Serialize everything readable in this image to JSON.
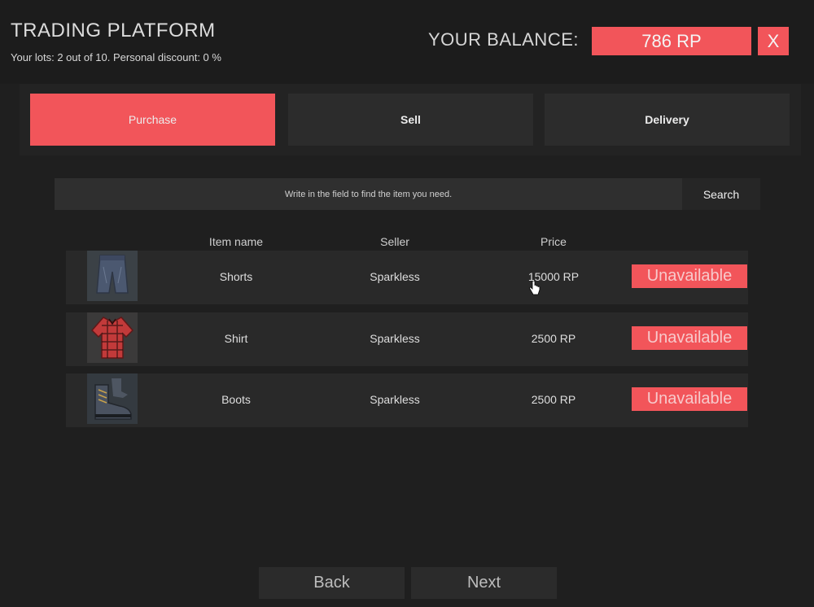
{
  "header": {
    "title": "TRADING PLATFORM",
    "subtitle": "Your lots: 2 out of 10. Personal discount: 0 %",
    "balance_label": "YOUR BALANCE:",
    "balance_value": "786 RP",
    "close_label": "X"
  },
  "tabs": [
    {
      "label": "Purchase",
      "active": true
    },
    {
      "label": "Sell",
      "active": false
    },
    {
      "label": "Delivery",
      "active": false
    }
  ],
  "search": {
    "placeholder": "Write in the field to find the item you need.",
    "button_label": "Search"
  },
  "table": {
    "columns": [
      "Item name",
      "Seller",
      "Price"
    ],
    "rows": [
      {
        "item": "Shorts",
        "seller": "Sparkless",
        "price": "15000 RP",
        "action": "Unavailable",
        "icon": "shorts-icon"
      },
      {
        "item": "Shirt",
        "seller": "Sparkless",
        "price": "2500 RP",
        "action": "Unavailable",
        "icon": "shirt-icon"
      },
      {
        "item": "Boots",
        "seller": "Sparkless",
        "price": "2500 RP",
        "action": "Unavailable",
        "icon": "boots-icon"
      }
    ]
  },
  "pagination": {
    "back_label": "Back",
    "next_label": "Next"
  },
  "colors": {
    "accent": "#f2555a",
    "background": "#1f1f1f",
    "panel": "#2c2c2c"
  }
}
